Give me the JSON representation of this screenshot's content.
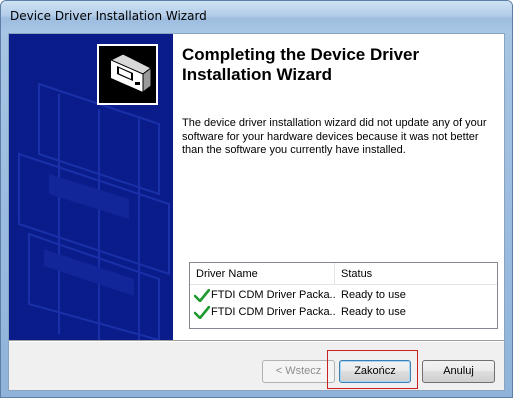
{
  "window": {
    "title": "Device Driver Installation Wizard"
  },
  "wizard": {
    "heading": "Completing the Device Driver Installation Wizard",
    "body": "The device driver installation wizard did not update any of your software for your hardware devices because it was not better than the software you currently have installed."
  },
  "drivers": {
    "columns": {
      "name": "Driver Name",
      "status": "Status"
    },
    "rows": [
      {
        "name": "FTDI CDM Driver Packa...",
        "status": "Ready to use",
        "icon": "checkmark-icon"
      },
      {
        "name": "FTDI CDM Driver Packa...",
        "status": "Ready to use",
        "icon": "checkmark-icon"
      }
    ]
  },
  "buttons": {
    "back": "< Wstecz",
    "finish": "Zakończ",
    "cancel": "Anuluj"
  },
  "colors": {
    "banner": "#0a1c8a",
    "check": "#1e9a2e",
    "highlight": "#cc1f1f"
  }
}
